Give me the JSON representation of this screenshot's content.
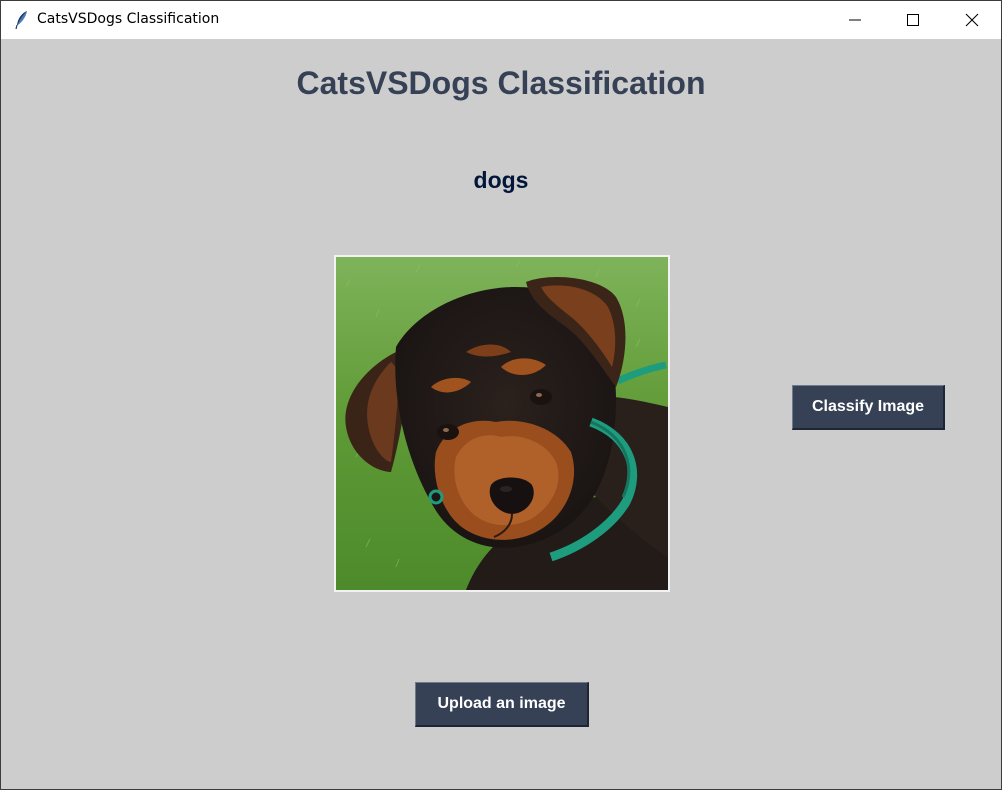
{
  "window": {
    "title": "CatsVSDogs Classification",
    "icon": "feather-icon",
    "controls": [
      "minimize-icon",
      "maximize-icon",
      "close-icon"
    ]
  },
  "main": {
    "heading": "CatsVSDogs Classification",
    "result_label": "dogs",
    "image": "uploaded dog photo",
    "classify_button": "Classify Image",
    "upload_button": "Upload an image"
  },
  "colors": {
    "background": "#cdcdcd",
    "heading": "#364156",
    "result": "#011638",
    "button_bg": "#364156",
    "button_text": "#ffffff"
  }
}
